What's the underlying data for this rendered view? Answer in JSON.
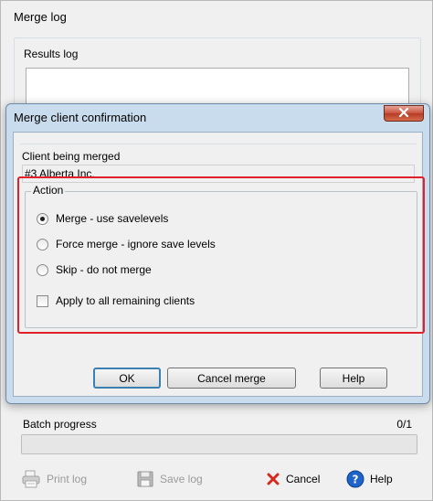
{
  "background_window": {
    "title": "Merge log",
    "results_label": "Results log",
    "batch_label": "Batch progress",
    "batch_count": "0/1",
    "buttons": {
      "print_log": "Print log",
      "save_log": "Save log",
      "cancel": "Cancel",
      "help": "Help"
    }
  },
  "dialog": {
    "title": "Merge client confirmation",
    "close_glyph": "X",
    "client_label": "Client being merged",
    "client_value": "#3  Alberta Inc.",
    "action_legend": "Action",
    "options": [
      {
        "label": "Merge - use savelevels",
        "checked": true
      },
      {
        "label": "Force merge - ignore save levels",
        "checked": false
      },
      {
        "label": "Skip - do not merge",
        "checked": false
      }
    ],
    "apply_all": {
      "label": "Apply to all remaining clients",
      "checked": false
    },
    "buttons": {
      "ok": "OK",
      "cancel_merge": "Cancel merge",
      "help": "Help"
    },
    "highlight_color": "#e0202a"
  },
  "colors": {
    "dialog_frame": "#c9dcee",
    "window_bg": "#f0f0f0",
    "cancel_icon": "#d42a1e",
    "help_icon": "#1e64c8"
  }
}
